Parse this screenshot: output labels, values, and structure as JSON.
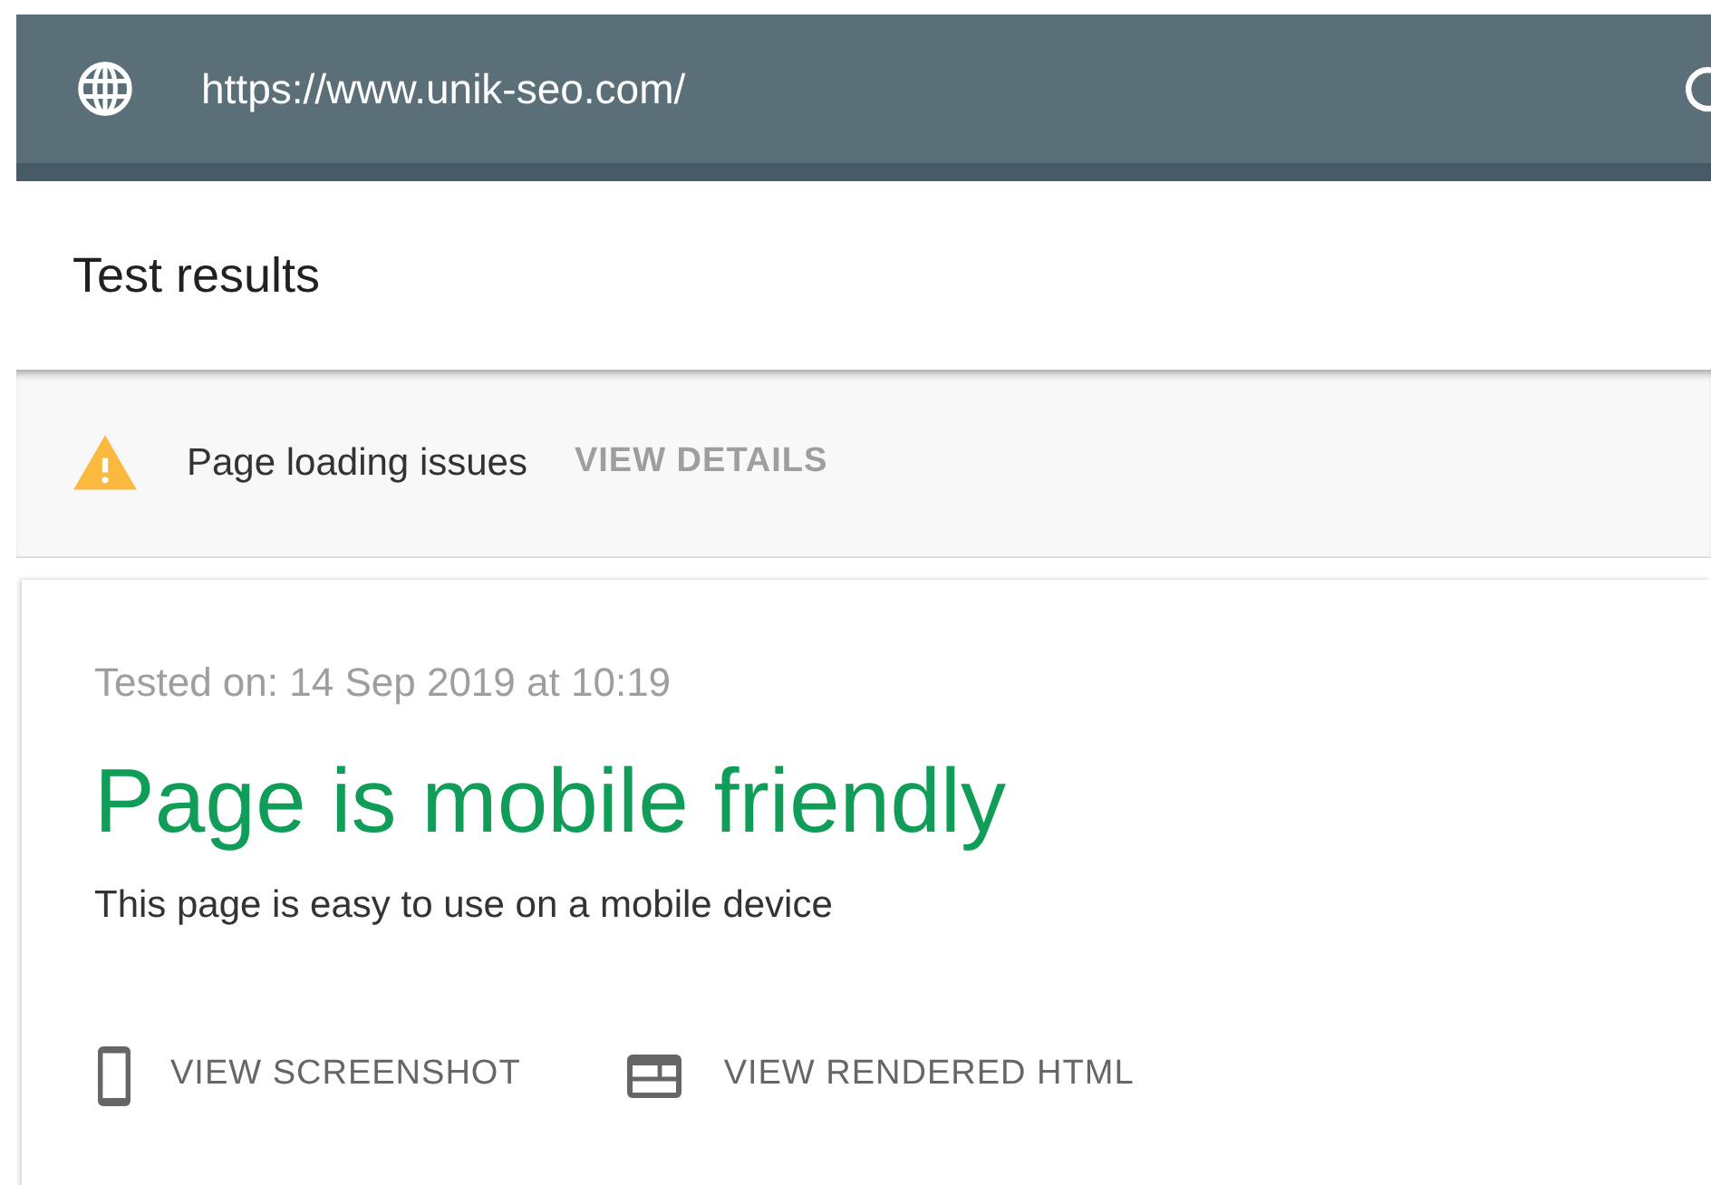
{
  "url_bar": {
    "url": "https://www.unik-seo.com/"
  },
  "header": {
    "title": "Test results"
  },
  "issues_bar": {
    "text": "Page loading issues",
    "action": "VIEW DETAILS"
  },
  "result": {
    "tested_on": "Tested on: 14 Sep 2019 at 10:19",
    "verdict": "Page is mobile friendly",
    "description": "This page is easy to use on a mobile device",
    "actions": [
      {
        "kind": "screenshot",
        "label": "VIEW SCREENSHOT"
      },
      {
        "kind": "html",
        "label": "VIEW RENDERED HTML"
      }
    ]
  }
}
